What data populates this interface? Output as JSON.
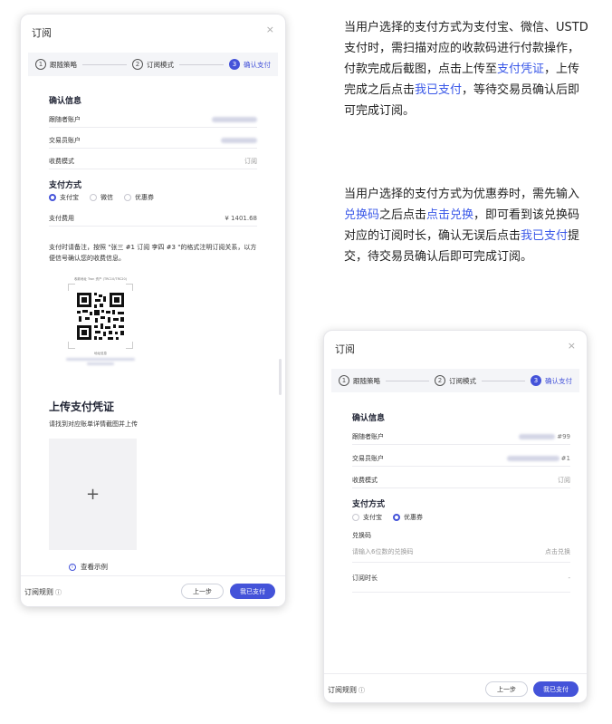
{
  "dialog1": {
    "title": "订阅",
    "close": "×",
    "steps": [
      {
        "num": "1",
        "label": "跟随策略"
      },
      {
        "num": "2",
        "label": "订阅模式"
      },
      {
        "num": "3",
        "label": "确认支付"
      }
    ],
    "confirm_title": "确认信息",
    "follower_label": "跟随者账户",
    "trader_label": "交易员账户",
    "fee_mode_label": "收费模式",
    "fee_mode_value": "订阅",
    "payment_title": "支付方式",
    "methods": [
      "支付宝",
      "微信",
      "优惠券"
    ],
    "fee_label": "支付费用",
    "fee_value": "¥ 1401.68",
    "note": "支付时请备注，按照 \"张三 #1 订阅 李四 #3 \"的格式注明订阅关系，以方便信号确认您的收费信息。",
    "qr_caption_top": "收款地址 Tron 资产 (TRC10/TRC20)",
    "qr_caption_bottom": "地址信息",
    "upload_title": "上传支付凭证",
    "upload_sub": "请找到对应账单详情截图并上传",
    "upload_plus": "+",
    "example": "查看示例",
    "rules": "订阅规则",
    "prev": "上一步",
    "done": "我已支付"
  },
  "dialog2": {
    "title": "订阅",
    "close": "×",
    "steps": [
      {
        "num": "1",
        "label": "跟随策略"
      },
      {
        "num": "2",
        "label": "订阅模式"
      },
      {
        "num": "3",
        "label": "确认支付"
      }
    ],
    "confirm_title": "确认信息",
    "follower_label": "跟随者账户",
    "follower_suffix": "#99",
    "trader_label": "交易员账户",
    "trader_suffix": "#1",
    "fee_mode_label": "收费模式",
    "fee_mode_value": "订阅",
    "payment_title": "支付方式",
    "methods": [
      "支付宝",
      "优惠券"
    ],
    "code_label": "兑换码",
    "code_placeholder": "请输入6位数的兑换码",
    "code_action": "点击兑换",
    "duration_label": "订阅时长",
    "duration_value": "-",
    "rules": "订阅规则",
    "prev": "上一步",
    "done": "我已支付"
  },
  "desc1": {
    "t1": "当用户选择的支付方式为支付宝、微信、USTD支付时，需扫描对应的收款码进行付款操作，付款完成后截图，点击上传至",
    "l1": "支付凭证",
    "t2": "，上传完成之后点击",
    "l2": "我已支付",
    "t3": "，等待交易员确认后即可完成订阅。"
  },
  "desc2": {
    "t1": "当用户选择的支付方式为优惠券时，需先输入",
    "l1": "兑换码",
    "t2": "之后点击",
    "l2": "点击兑换",
    "t3": "，即可看到该兑换码对应的订阅时长，确认无误后点击",
    "l3": "我已支付",
    "t4": "提交，待交易员确认后即可完成订阅。"
  },
  "colors": {
    "accent": "#4453d9",
    "link": "#3a58e8"
  }
}
